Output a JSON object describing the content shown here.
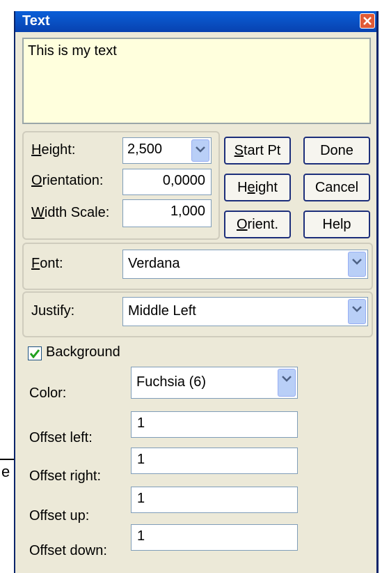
{
  "window": {
    "title": "Text"
  },
  "text_content": "This is my text",
  "params": {
    "height_label": "Height:",
    "height_value": "2,500",
    "orientation_label": "Orientation:",
    "orientation_value": "0,0000",
    "width_scale_label": "Width Scale:",
    "width_scale_value": "1,000"
  },
  "buttons": {
    "start_pt": "Start Pt",
    "done": "Done",
    "height": "Height",
    "cancel": "Cancel",
    "orient": "Orient.",
    "help": "Help"
  },
  "font": {
    "label": "Font:",
    "value": "Verdana"
  },
  "justify": {
    "label": "Justify:",
    "value": "Middle Left"
  },
  "background": {
    "checkbox_label": "Background",
    "checked": true,
    "color_label": "Color:",
    "color_value": "Fuchsia (6)",
    "offset_left_label": "Offset left:",
    "offset_left_value": "1",
    "offset_right_label": "Offset right:",
    "offset_right_value": "1",
    "offset_up_label": "Offset up:",
    "offset_up_value": "1",
    "offset_down_label": "Offset down:",
    "offset_down_value": "1"
  },
  "backdrop_fragment": "e",
  "colors": {
    "title_bar": "#0a5fd8",
    "dialog_bg": "#ece9d8",
    "text_area_bg": "#ffffdd",
    "close_button": "#e05a36"
  }
}
